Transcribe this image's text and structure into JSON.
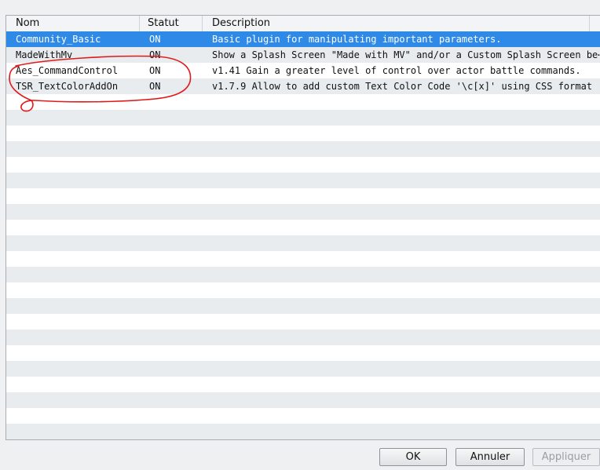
{
  "table": {
    "columns": [
      "Nom",
      "Statut",
      "Description"
    ],
    "rows": [
      {
        "name": "Community_Basic",
        "status": "ON",
        "description": "Basic plugin for manipulating important parameters.",
        "selected": true
      },
      {
        "name": "MadeWithMv",
        "status": "ON",
        "description": "Show a Splash Screen \"Made with MV\" and/or a Custom Splash Screen be⋯",
        "selected": false
      },
      {
        "name": "Aes_CommandControl",
        "status": "ON",
        "description": "v1.41 Gain a greater level of control over actor battle commands.",
        "selected": false
      },
      {
        "name": "TSR_TextColorAddOn",
        "status": "ON",
        "description": "v1.7.9 Allow to add custom Text Color Code '\\c[x]' using CSS format",
        "selected": false
      }
    ]
  },
  "buttons": {
    "ok": "OK",
    "cancel": "Annuler",
    "apply": "Appliquer"
  },
  "colors": {
    "selection": "#2e8ae6",
    "annotation": "#e0191b"
  }
}
